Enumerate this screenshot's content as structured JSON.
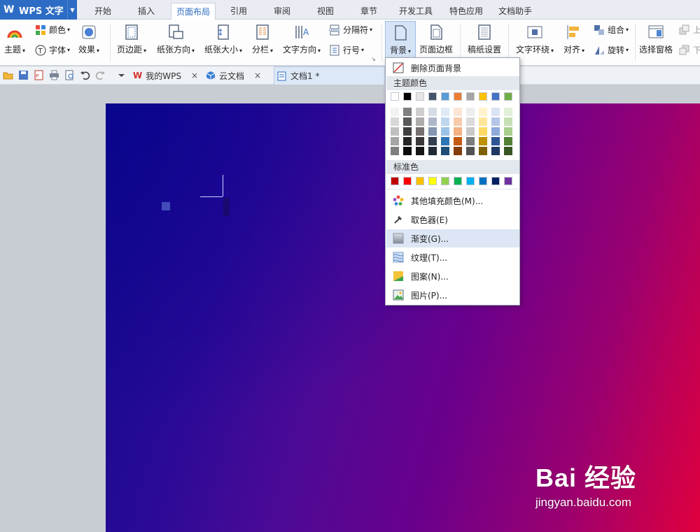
{
  "app": {
    "logo": "W",
    "title": "WPS 文字"
  },
  "ribbon_tabs": [
    "开始",
    "插入",
    "页面布局",
    "引用",
    "审阅",
    "视图",
    "章节",
    "开发工具",
    "特色应用",
    "文档助手"
  ],
  "active_tab": "页面布局",
  "ribbon": {
    "theme": "主题",
    "colors": "颜色",
    "font": "字体",
    "effects": "效果",
    "margins": "页边距",
    "orientation": "纸张方向",
    "size": "纸张大小",
    "columns": "分栏",
    "text_direction": "文字方向",
    "breaks": "分隔符",
    "line_numbers": "行号",
    "background": "背景",
    "page_border": "页面边框",
    "draft_paper": "稿纸设置",
    "wrap_text": "文字环绕",
    "align": "对齐",
    "group": "组合",
    "rotate": "旋转",
    "selection_pane": "选择窗格",
    "bring_forward": "上",
    "send_backward": "下"
  },
  "doc_tabs": [
    {
      "label": "我的WPS",
      "close": "×"
    },
    {
      "label": "云文档",
      "close": "×"
    },
    {
      "label": "文档1 *",
      "close": ""
    }
  ],
  "menu": {
    "remove_bg": "删除页面背景",
    "theme_colors_header": "主题颜色",
    "standard_colors_header": "标准色",
    "more_colors": "其他填充颜色(M)...",
    "eyedropper": "取色器(E)",
    "gradient": "渐变(G)...",
    "texture": "纹理(T)...",
    "pattern": "图案(N)...",
    "picture": "图片(P)..."
  },
  "theme_colors": [
    "#ffffff",
    "#000000",
    "#e7e6e6",
    "#44546a",
    "#5b9bd5",
    "#ed7d31",
    "#a5a5a5",
    "#ffc000",
    "#4472c4",
    "#70ad47"
  ],
  "theme_shades": [
    [
      "#f2f2f2",
      "#7f7f7f",
      "#d0cece",
      "#d6dce4",
      "#deebf6",
      "#fbe5d5",
      "#ededed",
      "#fff2cc",
      "#dae3f3",
      "#e2efd9"
    ],
    [
      "#d8d8d8",
      "#595959",
      "#aeabab",
      "#adb9ca",
      "#bdd7ee",
      "#f7cbac",
      "#dbdbdb",
      "#fee599",
      "#b4c6e7",
      "#c5e0b3"
    ],
    [
      "#bfbfbf",
      "#3f3f3f",
      "#757070",
      "#8496b0",
      "#9cc3e5",
      "#f4b183",
      "#c9c9c9",
      "#ffd965",
      "#8eaadb",
      "#a8d08d"
    ],
    [
      "#a5a5a5",
      "#262626",
      "#3a3838",
      "#323f4f",
      "#2e75b5",
      "#c55a11",
      "#7b7b7b",
      "#bf9000",
      "#2f5496",
      "#538135"
    ],
    [
      "#7f7f7f",
      "#0c0c0c",
      "#171616",
      "#222a35",
      "#1e4e79",
      "#833c0b",
      "#525252",
      "#7f6000",
      "#1f3864",
      "#375623"
    ]
  ],
  "standard_colors": [
    "#c00000",
    "#ff0000",
    "#ffc000",
    "#ffff00",
    "#92d050",
    "#00b050",
    "#00b0f0",
    "#0070c0",
    "#002060",
    "#7030a0"
  ],
  "watermark": {
    "brand": "Bai 经验",
    "url": "jingyan.baidu.com"
  }
}
